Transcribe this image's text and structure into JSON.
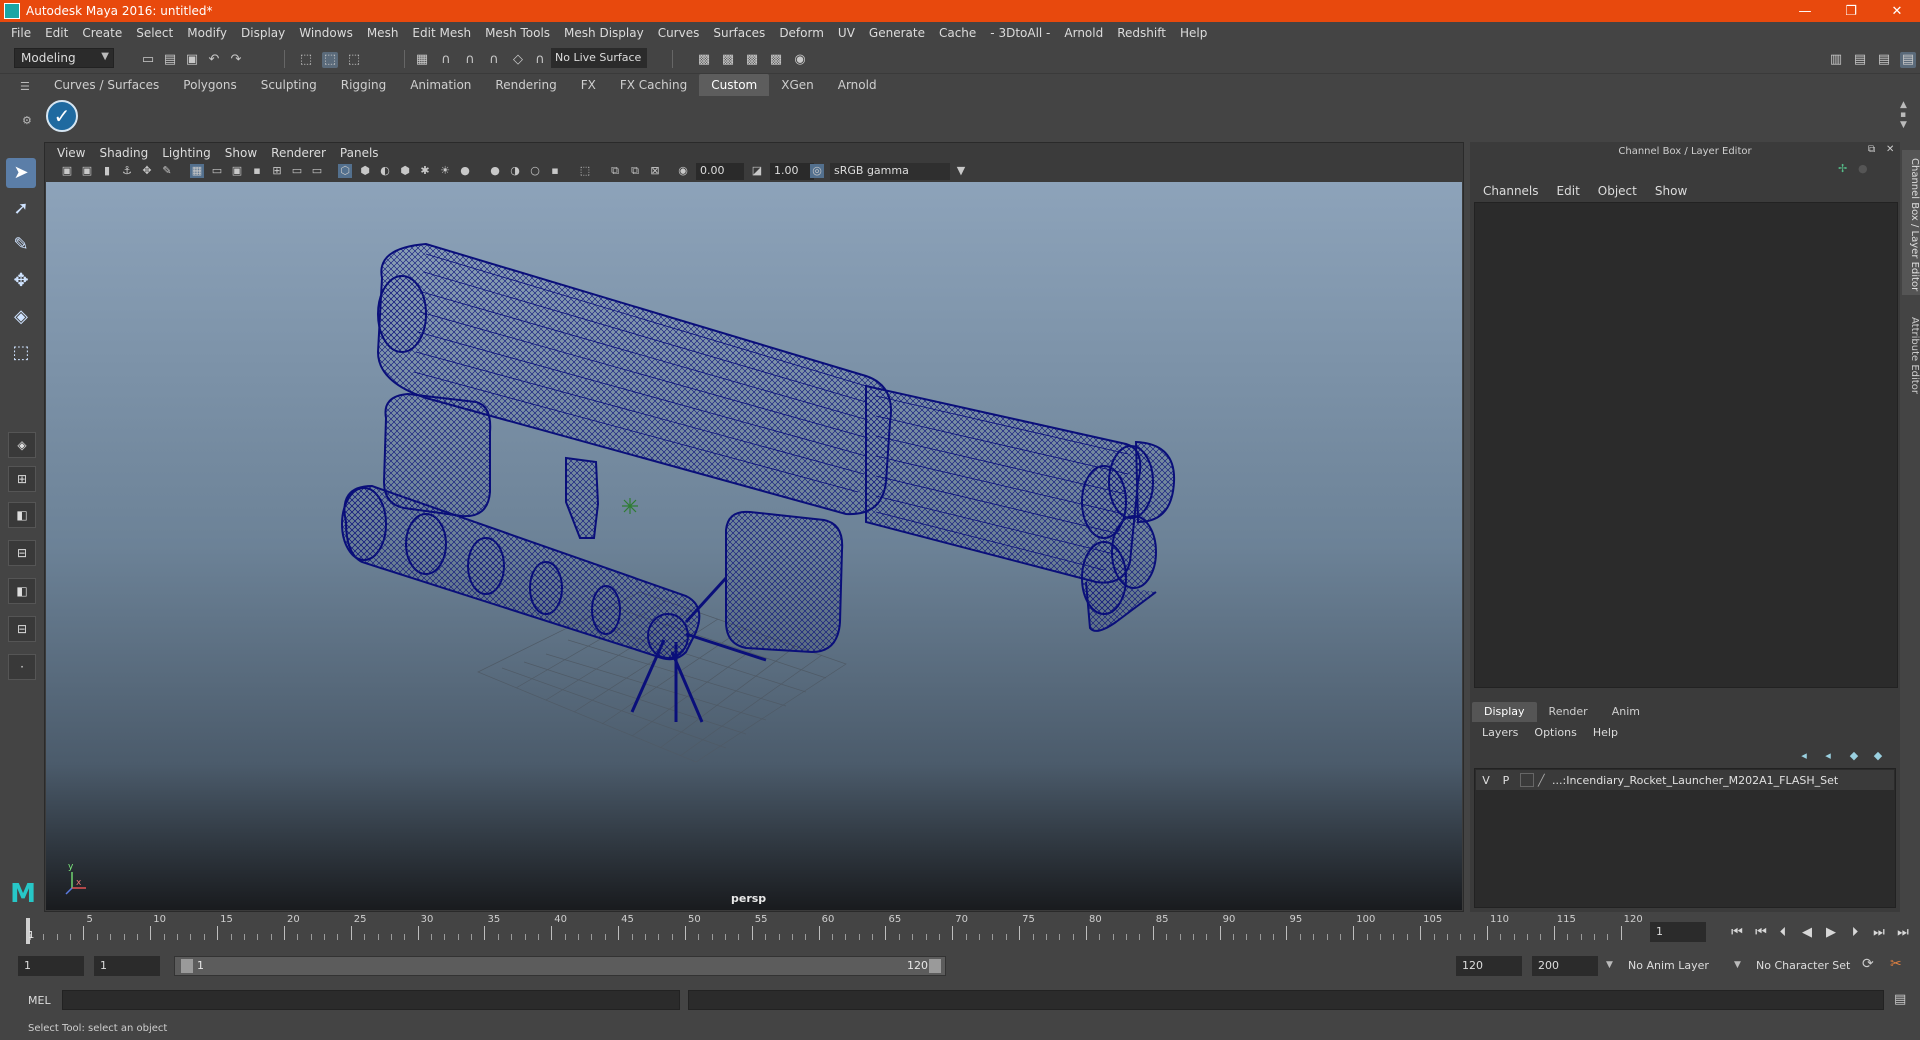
{
  "window": {
    "title": "Autodesk Maya 2016: untitled*",
    "minimize": "—",
    "maximize": "❐",
    "close": "✕"
  },
  "menus": [
    "File",
    "Edit",
    "Create",
    "Select",
    "Modify",
    "Display",
    "Windows",
    "Mesh",
    "Edit Mesh",
    "Mesh Tools",
    "Mesh Display",
    "Curves",
    "Surfaces",
    "Deform",
    "UV",
    "Generate",
    "Cache",
    "- 3DtoAll -",
    "Arnold",
    "Redshift",
    "Help"
  ],
  "status_line": {
    "mode": "Modeling",
    "live_surface": "No Live Surface"
  },
  "shelf_tabs": [
    "Curves / Surfaces",
    "Polygons",
    "Sculpting",
    "Rigging",
    "Animation",
    "Rendering",
    "FX",
    "FX Caching",
    "Custom",
    "XGen",
    "Arnold"
  ],
  "active_shelf_tab": "Custom",
  "viewport": {
    "menus": [
      "View",
      "Shading",
      "Lighting",
      "Show",
      "Renderer",
      "Panels"
    ],
    "exposure": "0.00",
    "gamma": "1.00",
    "color_space": "sRGB gamma",
    "camera": "persp",
    "axis_y_label": "y",
    "axis_x_label": "x"
  },
  "channel_box": {
    "header": "Channel Box / Layer Editor",
    "menus": [
      "Channels",
      "Edit",
      "Object",
      "Show"
    ],
    "side_tab": "Channel Box / Layer Editor",
    "side_tab2": "Attribute Editor"
  },
  "layer_editor": {
    "tabs": [
      "Display",
      "Render",
      "Anim"
    ],
    "active_tab": "Display",
    "menus": [
      "Layers",
      "Options",
      "Help"
    ],
    "layers": [
      {
        "v": "V",
        "p": "P",
        "name": "...:Incendiary_Rocket_Launcher_M202A1_FLASH_Set"
      }
    ]
  },
  "timeline": {
    "tick_labels": [
      "5",
      "10",
      "15",
      "20",
      "25",
      "30",
      "35",
      "40",
      "45",
      "50",
      "55",
      "60",
      "65",
      "70",
      "75",
      "80",
      "85",
      "90",
      "95",
      "100",
      "105",
      "110",
      "115",
      "120"
    ],
    "start_label": "1",
    "current_frame": "1"
  },
  "range": {
    "start": "1",
    "playback_start": "1",
    "range_start_label": "1",
    "range_end_label": "120",
    "playback_end": "120",
    "end": "200",
    "anim_layer": "No Anim Layer",
    "character_set": "No Character Set"
  },
  "mel": {
    "label": "MEL"
  },
  "help_line": "Select Tool: select an object",
  "icons": {
    "select": "arrow-select-icon",
    "lasso": "lasso-icon",
    "paint": "paint-select-icon",
    "move": "move-icon",
    "rotate": "rotate-icon",
    "scale": "scale-icon"
  },
  "colors": {
    "title_bar": "#e8490d",
    "wireframe": "#0a0f7a",
    "accent": "#5b7ea8"
  }
}
